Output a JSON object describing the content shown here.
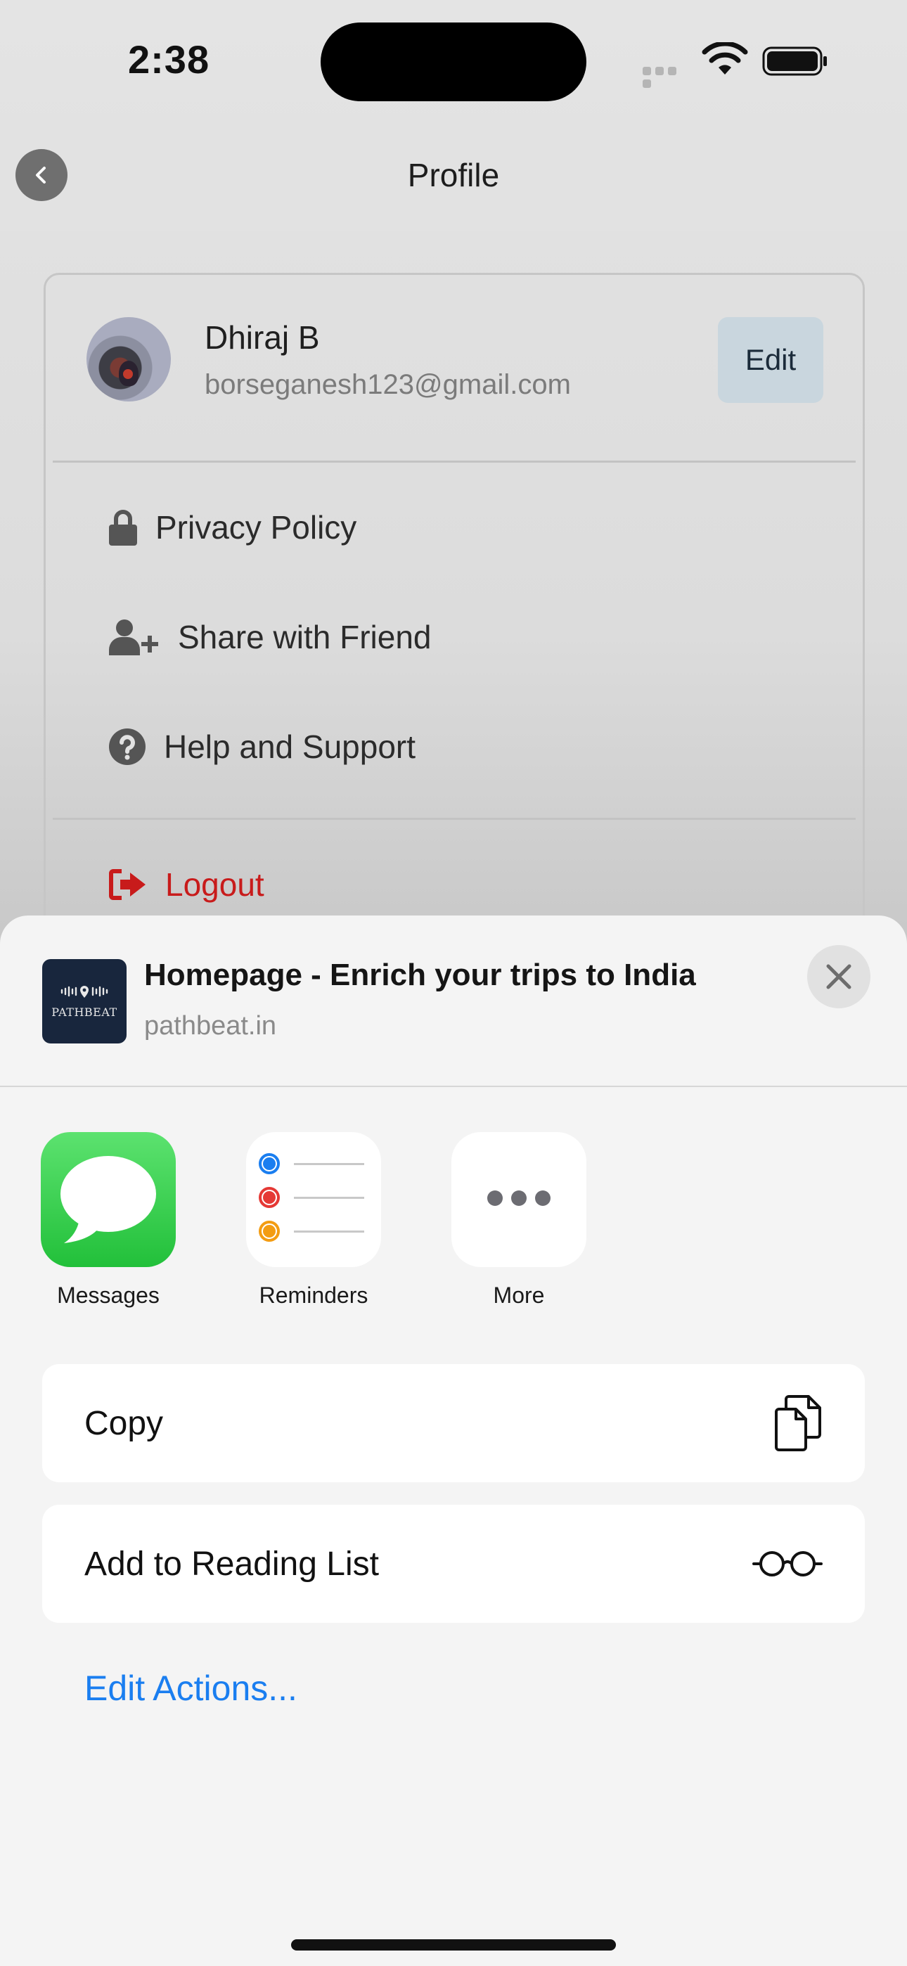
{
  "status_bar": {
    "time": "2:38"
  },
  "nav": {
    "title": "Profile"
  },
  "profile": {
    "name": "Dhiraj B",
    "email": "borseganesh123@gmail.com",
    "edit_label": "Edit"
  },
  "menu": {
    "privacy": "Privacy Policy",
    "share": "Share with Friend",
    "help": "Help and Support",
    "logout": "Logout"
  },
  "share_sheet": {
    "preview": {
      "title": "Homepage - Enrich your trips to India",
      "url": "pathbeat.in",
      "thumb_text": "PATHBEAT"
    },
    "apps": [
      {
        "label": "Messages",
        "icon": "messages-icon"
      },
      {
        "label": "Reminders",
        "icon": "reminders-icon"
      },
      {
        "label": "More",
        "icon": "more-icon"
      }
    ],
    "actions": [
      {
        "label": "Copy",
        "icon": "copy-icon"
      },
      {
        "label": "Add to Reading List",
        "icon": "glasses-icon"
      }
    ],
    "edit_actions": "Edit Actions..."
  },
  "colors": {
    "logout": "#c81b1b",
    "link": "#1a7ef0",
    "messages_green": "#2ac943",
    "edit_button_bg": "#c9d6de",
    "reminder_colors": [
      "#1a7ef0",
      "#e53935",
      "#f39c12"
    ]
  }
}
